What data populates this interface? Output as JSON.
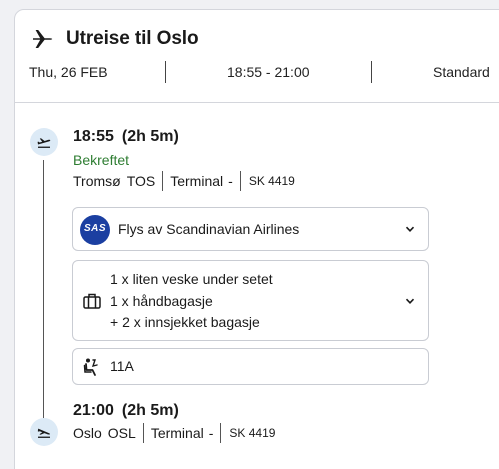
{
  "header": {
    "title": "Utreise til Oslo",
    "date": "Thu, 26 FEB",
    "time_range": "18:55 - 21:00",
    "fare_class": "Standard"
  },
  "departure": {
    "time": "18:55",
    "duration": "(2h 5m)",
    "status": "Bekreftet",
    "city": "Tromsø",
    "airport_code": "TOS",
    "terminal": "Terminal",
    "terminal_value": "-",
    "flight_number": "SK 4419"
  },
  "airline": {
    "logo_text": "SAS",
    "label": "Flys av Scandinavian Airlines"
  },
  "baggage": {
    "lines": [
      "1 x liten veske under setet",
      "1 x håndbagasje",
      "+ 2 x innsjekket bagasje"
    ]
  },
  "seat": {
    "number": "11A"
  },
  "arrival": {
    "time": "21:00",
    "duration": "(2h 5m)",
    "city": "Oslo",
    "airport_code": "OSL",
    "terminal": "Terminal",
    "terminal_value": "-",
    "flight_number": "SK 4419"
  },
  "icons": {
    "header": "plane-icon",
    "departure": "takeoff-icon",
    "arrival": "landing-icon",
    "baggage": "luggage-icon",
    "seat": "seat-icon",
    "expand": "chevron-down-icon"
  },
  "colors": {
    "status_confirmed": "#2e7d32",
    "sas_blue": "#1b3fa1",
    "timeline_icon_bg": "#dceaf6"
  }
}
